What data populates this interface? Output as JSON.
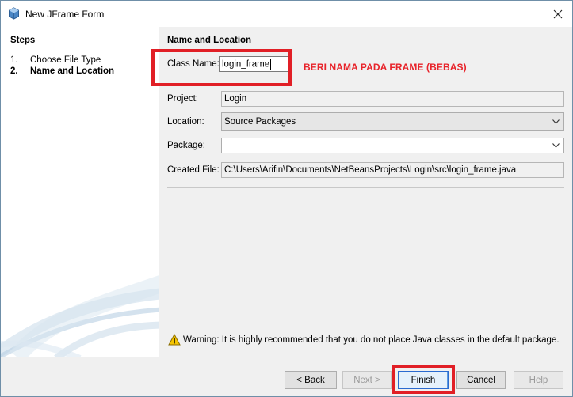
{
  "window": {
    "title": "New JFrame Form",
    "app_icon": "java-cup-icon",
    "close_icon": "close-icon"
  },
  "steps": {
    "heading": "Steps",
    "items": [
      {
        "num": "1.",
        "label": "Choose File Type",
        "current": false
      },
      {
        "num": "2.",
        "label": "Name and Location",
        "current": true
      }
    ]
  },
  "form": {
    "heading": "Name and Location",
    "class_name": {
      "label": "Class Name:",
      "value": "login_frame"
    },
    "project": {
      "label": "Project:",
      "value": "Login"
    },
    "location": {
      "label": "Location:",
      "value": "Source Packages"
    },
    "package": {
      "label": "Package:",
      "value": ""
    },
    "created_file": {
      "label": "Created File:",
      "value": "C:\\Users\\Arifin\\Documents\\NetBeansProjects\\Login\\src\\login_frame.java"
    },
    "annotation": "BERI NAMA PADA FRAME (BEBAS)",
    "warning": "Warning: It is highly recommended that you do not place Java classes in the default package.",
    "warning_icon": "warning-icon"
  },
  "buttons": {
    "back": "< Back",
    "next": "Next >",
    "finish": "Finish",
    "cancel": "Cancel",
    "help": "Help"
  },
  "colors": {
    "highlight": "#e11f26",
    "annotation_text": "#e8232a",
    "steps_panel_bg": "#ffffff",
    "content_bg": "#f0f0f0"
  }
}
